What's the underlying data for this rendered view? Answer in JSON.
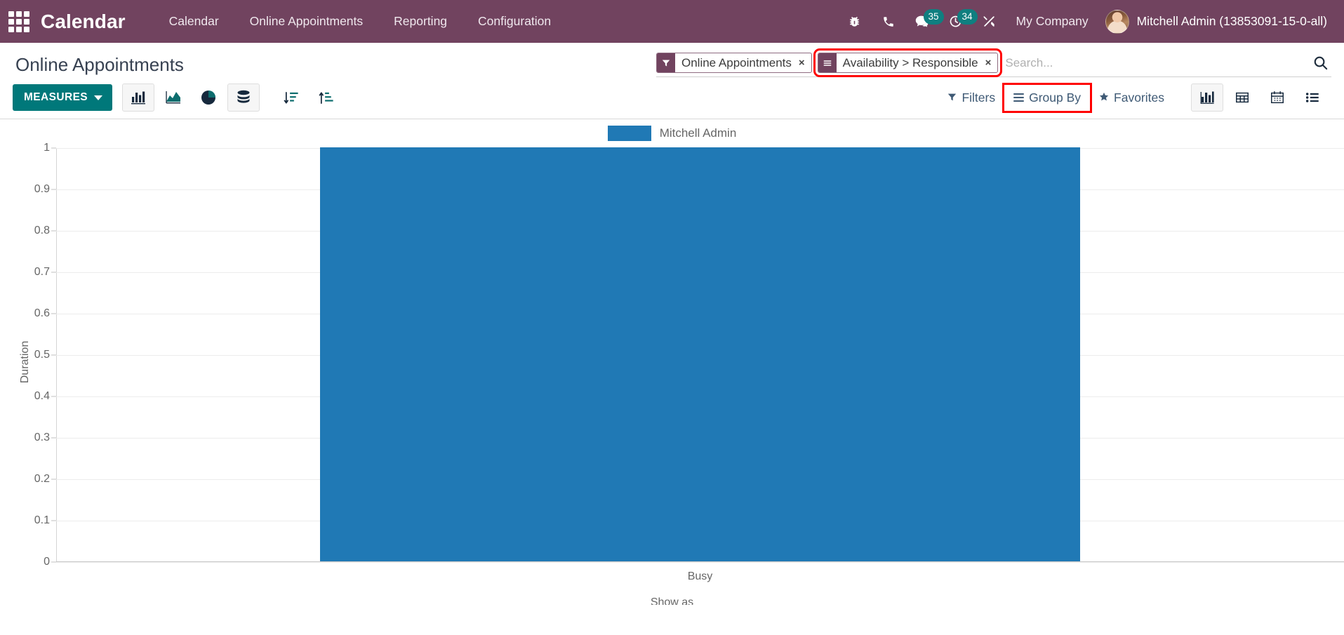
{
  "navbar": {
    "apps_icon": "apps-grid-icon",
    "brand": "Calendar",
    "menus": [
      {
        "label": "Calendar"
      },
      {
        "label": "Online Appointments"
      },
      {
        "label": "Reporting"
      },
      {
        "label": "Configuration"
      }
    ],
    "sys_icons": [
      {
        "name": "bug-icon",
        "badge": null
      },
      {
        "name": "phone-icon",
        "badge": null
      },
      {
        "name": "messages-icon",
        "badge": "35"
      },
      {
        "name": "activities-clock-icon",
        "badge": "34"
      },
      {
        "name": "tools-icon",
        "badge": null
      }
    ],
    "company": "My Company",
    "user": "Mitchell Admin (13853091-15-0-all)",
    "colors": {
      "background": "#71435f",
      "badge": "#0f7f80"
    }
  },
  "control_panel": {
    "breadcrumb": "Online Appointments",
    "search": {
      "placeholder": "Search...",
      "search_icon": "magnifier-icon",
      "facets": [
        {
          "icon": "filter-funnel-icon",
          "label": "Online Appointments",
          "remove": "×",
          "highlighted": false
        },
        {
          "icon": "group-by-bars-icon",
          "label": "Availability > Responsible",
          "remove": "×",
          "highlighted": true
        }
      ]
    },
    "measures_button": "MEASURES",
    "chart_type_buttons": [
      {
        "name": "bar-chart-button",
        "active": true
      },
      {
        "name": "line-chart-button",
        "active": false
      },
      {
        "name": "pie-chart-button",
        "active": false
      },
      {
        "name": "stacked-button",
        "active": true
      }
    ],
    "sort_buttons": [
      {
        "name": "sort-descending-button"
      },
      {
        "name": "sort-ascending-button"
      }
    ],
    "filter_menus": [
      {
        "label": "Filters",
        "icon": "filter-funnel-icon",
        "highlighted": false
      },
      {
        "label": "Group By",
        "icon": "hamburger-icon",
        "highlighted": true
      },
      {
        "label": "Favorites",
        "icon": "star-icon",
        "highlighted": false
      }
    ],
    "view_switcher": [
      {
        "name": "graph-view-button",
        "active": true
      },
      {
        "name": "pivot-view-button",
        "active": false
      },
      {
        "name": "calendar-view-button",
        "active": false
      },
      {
        "name": "list-view-button",
        "active": false
      }
    ],
    "highlight_color": "#ff0000"
  },
  "chart_data": {
    "type": "bar",
    "title": "",
    "categories": [
      "Busy"
    ],
    "series": [
      {
        "name": "Mitchell Admin",
        "values": [
          1
        ],
        "color": "#2079b5"
      }
    ],
    "xlabel": "Show as",
    "ylabel": "Duration",
    "ylim": [
      0,
      1
    ],
    "yticks": [
      "0",
      "0.1",
      "0.2",
      "0.3",
      "0.4",
      "0.5",
      "0.6",
      "0.7",
      "0.8",
      "0.9",
      "1"
    ],
    "grid": true,
    "legend_position": "top-center",
    "legend": [
      "Mitchell Admin"
    ]
  }
}
